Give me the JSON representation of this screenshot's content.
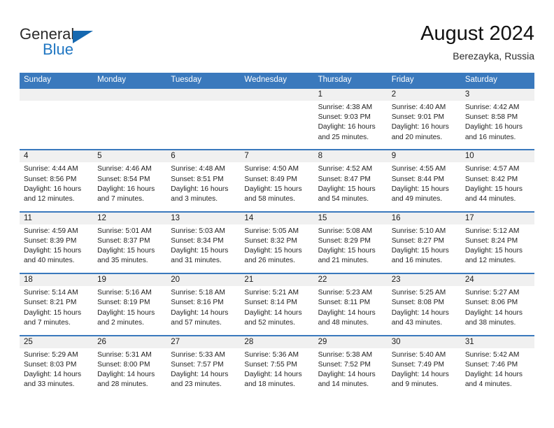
{
  "brand": {
    "name_top": "General",
    "name_bottom": "Blue",
    "triangle_icon": "brand-triangle-icon",
    "color_blue": "#1f76c2",
    "color_triangle": "#1568b0"
  },
  "header": {
    "title": "August 2024",
    "subtitle": "Berezayka, Russia"
  },
  "calendar": {
    "header_bg": "#3a79bd",
    "daynum_bg": "#f0f0f0",
    "weekdays": [
      "Sunday",
      "Monday",
      "Tuesday",
      "Wednesday",
      "Thursday",
      "Friday",
      "Saturday"
    ],
    "weeks": [
      [
        {
          "day": "",
          "lines": []
        },
        {
          "day": "",
          "lines": []
        },
        {
          "day": "",
          "lines": []
        },
        {
          "day": "",
          "lines": []
        },
        {
          "day": "1",
          "lines": [
            "Sunrise: 4:38 AM",
            "Sunset: 9:03 PM",
            "Daylight: 16 hours",
            "and 25 minutes."
          ]
        },
        {
          "day": "2",
          "lines": [
            "Sunrise: 4:40 AM",
            "Sunset: 9:01 PM",
            "Daylight: 16 hours",
            "and 20 minutes."
          ]
        },
        {
          "day": "3",
          "lines": [
            "Sunrise: 4:42 AM",
            "Sunset: 8:58 PM",
            "Daylight: 16 hours",
            "and 16 minutes."
          ]
        }
      ],
      [
        {
          "day": "4",
          "lines": [
            "Sunrise: 4:44 AM",
            "Sunset: 8:56 PM",
            "Daylight: 16 hours",
            "and 12 minutes."
          ]
        },
        {
          "day": "5",
          "lines": [
            "Sunrise: 4:46 AM",
            "Sunset: 8:54 PM",
            "Daylight: 16 hours",
            "and 7 minutes."
          ]
        },
        {
          "day": "6",
          "lines": [
            "Sunrise: 4:48 AM",
            "Sunset: 8:51 PM",
            "Daylight: 16 hours",
            "and 3 minutes."
          ]
        },
        {
          "day": "7",
          "lines": [
            "Sunrise: 4:50 AM",
            "Sunset: 8:49 PM",
            "Daylight: 15 hours",
            "and 58 minutes."
          ]
        },
        {
          "day": "8",
          "lines": [
            "Sunrise: 4:52 AM",
            "Sunset: 8:47 PM",
            "Daylight: 15 hours",
            "and 54 minutes."
          ]
        },
        {
          "day": "9",
          "lines": [
            "Sunrise: 4:55 AM",
            "Sunset: 8:44 PM",
            "Daylight: 15 hours",
            "and 49 minutes."
          ]
        },
        {
          "day": "10",
          "lines": [
            "Sunrise: 4:57 AM",
            "Sunset: 8:42 PM",
            "Daylight: 15 hours",
            "and 44 minutes."
          ]
        }
      ],
      [
        {
          "day": "11",
          "lines": [
            "Sunrise: 4:59 AM",
            "Sunset: 8:39 PM",
            "Daylight: 15 hours",
            "and 40 minutes."
          ]
        },
        {
          "day": "12",
          "lines": [
            "Sunrise: 5:01 AM",
            "Sunset: 8:37 PM",
            "Daylight: 15 hours",
            "and 35 minutes."
          ]
        },
        {
          "day": "13",
          "lines": [
            "Sunrise: 5:03 AM",
            "Sunset: 8:34 PM",
            "Daylight: 15 hours",
            "and 31 minutes."
          ]
        },
        {
          "day": "14",
          "lines": [
            "Sunrise: 5:05 AM",
            "Sunset: 8:32 PM",
            "Daylight: 15 hours",
            "and 26 minutes."
          ]
        },
        {
          "day": "15",
          "lines": [
            "Sunrise: 5:08 AM",
            "Sunset: 8:29 PM",
            "Daylight: 15 hours",
            "and 21 minutes."
          ]
        },
        {
          "day": "16",
          "lines": [
            "Sunrise: 5:10 AM",
            "Sunset: 8:27 PM",
            "Daylight: 15 hours",
            "and 16 minutes."
          ]
        },
        {
          "day": "17",
          "lines": [
            "Sunrise: 5:12 AM",
            "Sunset: 8:24 PM",
            "Daylight: 15 hours",
            "and 12 minutes."
          ]
        }
      ],
      [
        {
          "day": "18",
          "lines": [
            "Sunrise: 5:14 AM",
            "Sunset: 8:21 PM",
            "Daylight: 15 hours",
            "and 7 minutes."
          ]
        },
        {
          "day": "19",
          "lines": [
            "Sunrise: 5:16 AM",
            "Sunset: 8:19 PM",
            "Daylight: 15 hours",
            "and 2 minutes."
          ]
        },
        {
          "day": "20",
          "lines": [
            "Sunrise: 5:18 AM",
            "Sunset: 8:16 PM",
            "Daylight: 14 hours",
            "and 57 minutes."
          ]
        },
        {
          "day": "21",
          "lines": [
            "Sunrise: 5:21 AM",
            "Sunset: 8:14 PM",
            "Daylight: 14 hours",
            "and 52 minutes."
          ]
        },
        {
          "day": "22",
          "lines": [
            "Sunrise: 5:23 AM",
            "Sunset: 8:11 PM",
            "Daylight: 14 hours",
            "and 48 minutes."
          ]
        },
        {
          "day": "23",
          "lines": [
            "Sunrise: 5:25 AM",
            "Sunset: 8:08 PM",
            "Daylight: 14 hours",
            "and 43 minutes."
          ]
        },
        {
          "day": "24",
          "lines": [
            "Sunrise: 5:27 AM",
            "Sunset: 8:06 PM",
            "Daylight: 14 hours",
            "and 38 minutes."
          ]
        }
      ],
      [
        {
          "day": "25",
          "lines": [
            "Sunrise: 5:29 AM",
            "Sunset: 8:03 PM",
            "Daylight: 14 hours",
            "and 33 minutes."
          ]
        },
        {
          "day": "26",
          "lines": [
            "Sunrise: 5:31 AM",
            "Sunset: 8:00 PM",
            "Daylight: 14 hours",
            "and 28 minutes."
          ]
        },
        {
          "day": "27",
          "lines": [
            "Sunrise: 5:33 AM",
            "Sunset: 7:57 PM",
            "Daylight: 14 hours",
            "and 23 minutes."
          ]
        },
        {
          "day": "28",
          "lines": [
            "Sunrise: 5:36 AM",
            "Sunset: 7:55 PM",
            "Daylight: 14 hours",
            "and 18 minutes."
          ]
        },
        {
          "day": "29",
          "lines": [
            "Sunrise: 5:38 AM",
            "Sunset: 7:52 PM",
            "Daylight: 14 hours",
            "and 14 minutes."
          ]
        },
        {
          "day": "30",
          "lines": [
            "Sunrise: 5:40 AM",
            "Sunset: 7:49 PM",
            "Daylight: 14 hours",
            "and 9 minutes."
          ]
        },
        {
          "day": "31",
          "lines": [
            "Sunrise: 5:42 AM",
            "Sunset: 7:46 PM",
            "Daylight: 14 hours",
            "and 4 minutes."
          ]
        }
      ]
    ]
  }
}
